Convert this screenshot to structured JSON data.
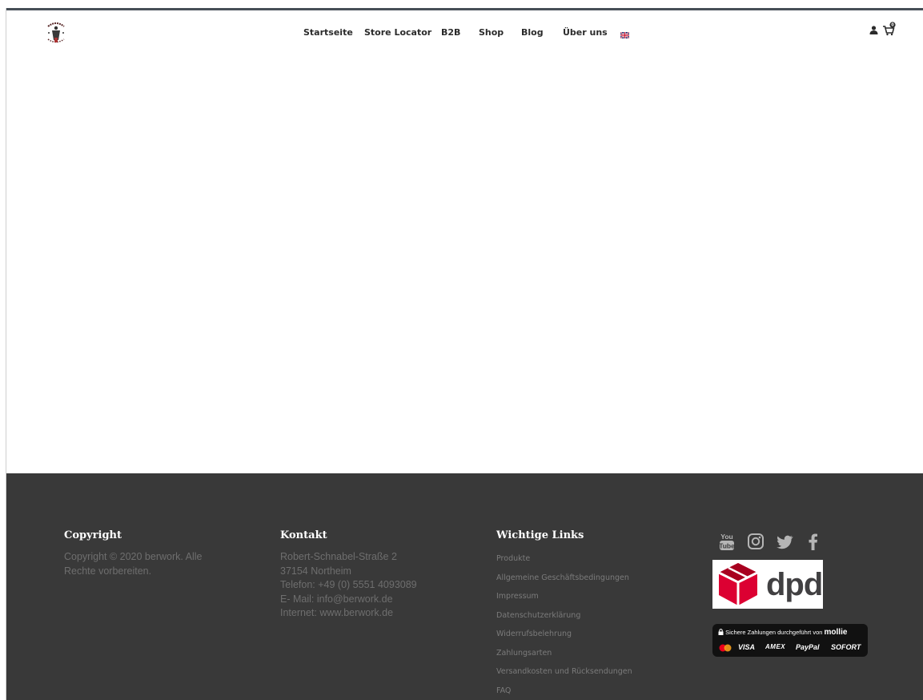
{
  "nav": {
    "items": [
      {
        "label": "Startseite"
      },
      {
        "label": "Store Locator"
      },
      {
        "label": "B2B"
      },
      {
        "label": "Shop"
      },
      {
        "label": "Blog"
      },
      {
        "label": "Über uns"
      }
    ]
  },
  "header": {
    "logo_text_top": "BERWORK",
    "logo_text_bottom": "SINCE 2020",
    "cart_count": "0"
  },
  "footer": {
    "copyright": {
      "title": "Copyright",
      "lines": [
        "Copyright © 2020 berwork. Alle",
        "Rechte vorbereiten."
      ]
    },
    "kontakt": {
      "title": "Kontakt",
      "lines": [
        "Robert-Schnabel-Straße 2",
        "37154 Northeim",
        "Telefon: +49 (0) 5551 4093089",
        "E- Mail:  info@berwork.de",
        "Internet: www.berwork.de"
      ]
    },
    "links": {
      "title": "Wichtige Links",
      "items": [
        "Produkte",
        "Allgemeine Geschäftsbedingungen",
        "Impressum",
        "Datenschutzerklärung",
        "Widerrufsbelehrung",
        "Zahlungsarten",
        "Versandkosten und Rücksendungen",
        "FAQ"
      ]
    },
    "badges": {
      "dpd": "dpd",
      "mollie_text": "Sichere Zahlungen durchgeführt von",
      "mollie_brand": "mollie",
      "payments": [
        "VISA",
        "AMEX",
        "PayPal",
        "SOFORT"
      ]
    },
    "social": [
      "youtube-icon",
      "instagram-icon",
      "twitter-icon",
      "facebook-icon"
    ]
  },
  "colors": {
    "footer_bg": "#393939",
    "footer_text": "#6e6e6e",
    "nav_text": "#2b2b2b",
    "dpd_red": "#dc0032"
  }
}
